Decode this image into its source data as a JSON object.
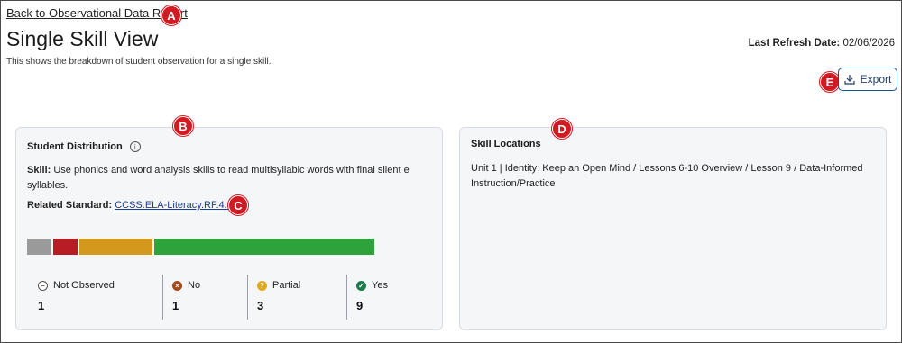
{
  "header": {
    "back_link": "Back to Observational Data Report",
    "title": "Single Skill View",
    "description": "This shows the breakdown of student observation for a single skill.",
    "refresh_label": "Last Refresh Date:",
    "refresh_date": "02/06/2026",
    "export_label": "Export"
  },
  "markers": {
    "a": "A",
    "b": "B",
    "c": "C",
    "d": "D",
    "e": "E"
  },
  "distribution": {
    "title": "Student Distribution",
    "skill_label": "Skill:",
    "skill_text": "Use phonics and word analysis skills to read multisyllabic words with final silent e syllables.",
    "standard_label": "Related Standard:",
    "standard_link": "CCSS.ELA-Literacy.RF.4.3",
    "stats": [
      {
        "label": "Not Observed",
        "value": "1",
        "color": "#9a9a9a",
        "icon": "minus-circle-icon"
      },
      {
        "label": "No",
        "value": "1",
        "color": "#b81d26",
        "icon": "x-circle-icon"
      },
      {
        "label": "Partial",
        "value": "3",
        "color": "#d4991c",
        "icon": "question-circle-icon"
      },
      {
        "label": "Yes",
        "value": "9",
        "color": "#2ea33b",
        "icon": "check-circle-icon"
      }
    ]
  },
  "locations": {
    "title": "Skill Locations",
    "text": "Unit 1 | Identity: Keep an Open Mind / Lessons 6-10 Overview / Lesson 9 / Data-Informed Instruction/Practice"
  }
}
